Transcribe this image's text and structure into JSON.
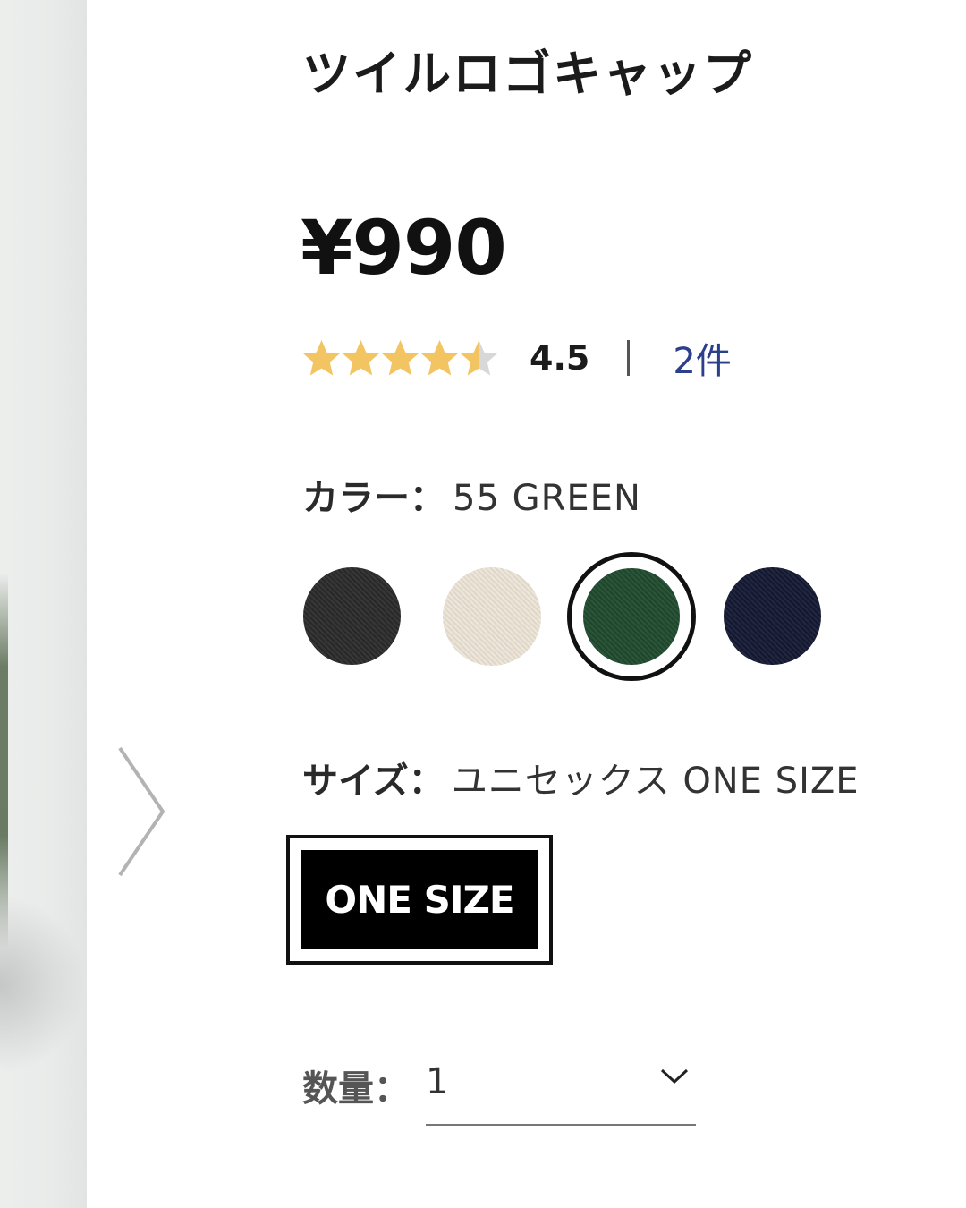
{
  "product": {
    "title": "ツイルロゴキャップ",
    "price": "¥990"
  },
  "rating": {
    "value": "4.5",
    "stars_filled": 4.5,
    "stars_total": 5,
    "review_count": "2件",
    "star_color": "#f2c462",
    "star_empty_color": "#d8d8d8"
  },
  "color_selector": {
    "label": "カラー：",
    "selected_value": "55 GREEN",
    "swatches": [
      {
        "name": "black",
        "hex": "#2b2b2b",
        "selected": false
      },
      {
        "name": "off-white",
        "hex": "#ece4d7",
        "selected": false
      },
      {
        "name": "green",
        "hex": "#1f4a2e",
        "selected": true
      },
      {
        "name": "navy",
        "hex": "#141a33",
        "selected": false
      }
    ]
  },
  "size_selector": {
    "label": "サイズ：",
    "selected_value": "ユニセックス ONE SIZE",
    "options": [
      "ONE SIZE"
    ]
  },
  "quantity": {
    "label": "数量：",
    "value": "1"
  },
  "icons": {
    "next": "chevron-right-icon",
    "dropdown": "chevron-down-icon"
  }
}
